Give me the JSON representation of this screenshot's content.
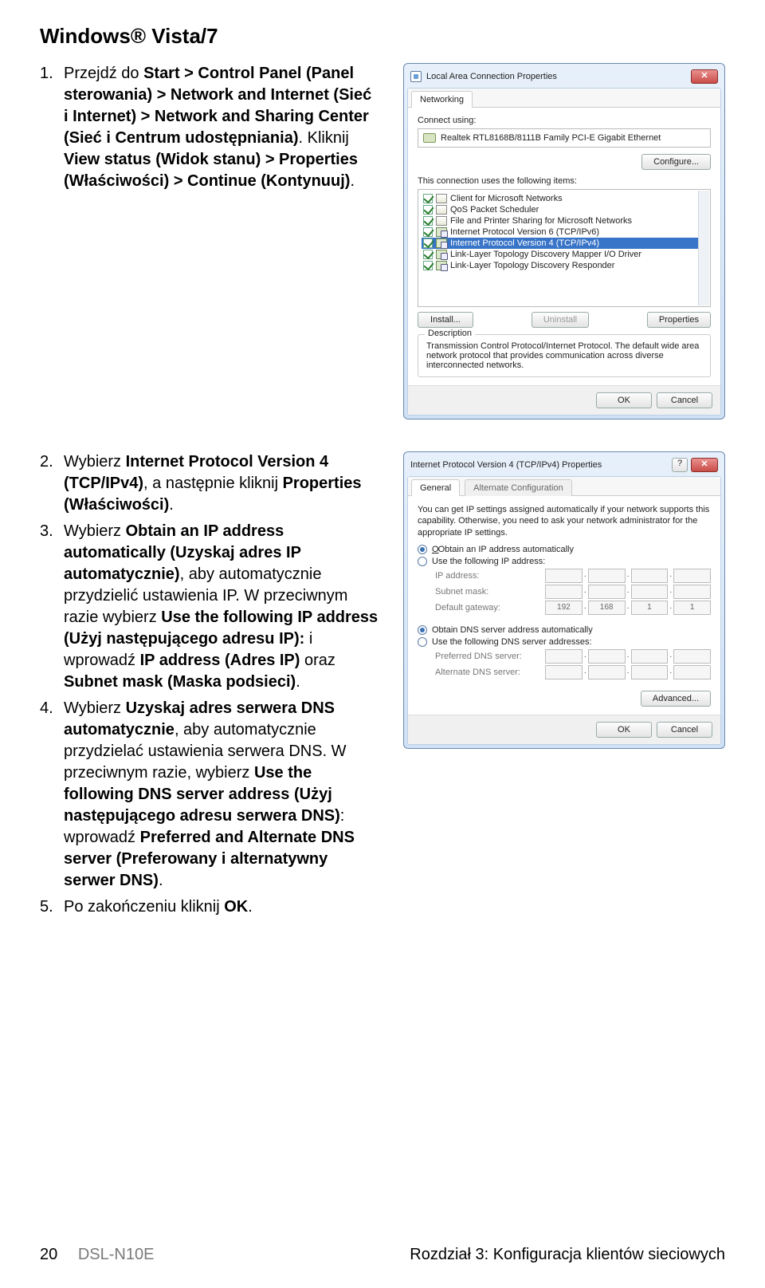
{
  "page": {
    "title": "Windows® Vista/7",
    "footer_page": "20",
    "footer_model": "DSL-N10E",
    "footer_chapter": "Rozdział 3: Konfiguracja klientów sieciowych"
  },
  "steps_a": [
    {
      "num": "1.",
      "pre": "Przejdź do ",
      "b1": "Start > Control Panel (Panel sterowania) > Network and Internet (Sieć i Internet) > Network and Sharing Center (Sieć i Centrum udostępniania)",
      "mid": ". Kliknij ",
      "b2": "View status (Widok stanu) > Properties (Właściwości) > Continue (Kontynuuj)",
      "post": "."
    }
  ],
  "steps_b": [
    {
      "num": "2.",
      "pre": "Wybierz ",
      "b1": "Internet Protocol Version 4 (TCP/IPv4)",
      "mid": ", a następnie kliknij ",
      "b2": "Properties (Właściwości)",
      "post": "."
    },
    {
      "num": "3.",
      "pre": "Wybierz ",
      "b1": "Obtain an IP address automatically (Uzyskaj adres IP automatycznie)",
      "mid": ", aby automatycznie przydzielić ustawienia IP. W przeciwnym razie wybierz ",
      "b2": "Use the following IP address (Użyj następującego adresu IP):",
      "mid2": " i wprowadź ",
      "b3": "IP address (Adres IP)",
      "mid3": " oraz ",
      "b4": "Subnet mask (Maska podsieci)",
      "post": "."
    },
    {
      "num": "4.",
      "pre": "Wybierz ",
      "b1": "Uzyskaj adres serwera DNS automatycznie",
      "mid": ", aby automatycznie przydzielać ustawienia serwera DNS. W przeciwnym razie, wybierz ",
      "b2": "Use the following DNS server address (Użyj następującego adresu serwera DNS)",
      "mid2": ": wprowadź ",
      "b3": "Preferred and Alternate DNS server (Preferowany i alternatywny serwer DNS)",
      "post": "."
    },
    {
      "num": "5.",
      "pre": "Po zakończeniu kliknij ",
      "b1": "OK",
      "post": "."
    }
  ],
  "dlg1": {
    "title": "Local Area Connection Properties",
    "tab": "Networking",
    "connect_using": "Connect using:",
    "nic": "Realtek RTL8168B/8111B Family PCI-E Gigabit Ethernet",
    "configure": "Configure...",
    "uses_label": "This connection uses the following items:",
    "items": [
      "Client for Microsoft Networks",
      "QoS Packet Scheduler",
      "File and Printer Sharing for Microsoft Networks",
      "Internet Protocol Version 6 (TCP/IPv6)",
      "Internet Protocol Version 4 (TCP/IPv4)",
      "Link-Layer Topology Discovery Mapper I/O Driver",
      "Link-Layer Topology Discovery Responder"
    ],
    "install": "Install...",
    "uninstall": "Uninstall",
    "properties": "Properties",
    "desc_legend": "Description",
    "description": "Transmission Control Protocol/Internet Protocol. The default wide area network protocol that provides communication across diverse interconnected networks.",
    "ok": "OK",
    "cancel": "Cancel"
  },
  "dlg2": {
    "title": "Internet Protocol Version 4 (TCP/IPv4) Properties",
    "tab_general": "General",
    "tab_alt": "Alternate Configuration",
    "intro": "You can get IP settings assigned automatically if your network supports this capability. Otherwise, you need to ask your network administrator for the appropriate IP settings.",
    "r_auto_ip": "Obtain an IP address automatically",
    "r_use_ip": "Use the following IP address:",
    "f_ip": "IP address:",
    "f_mask": "Subnet mask:",
    "f_gw": "Default gateway:",
    "gw_vals": [
      "192",
      "168",
      "1",
      "1"
    ],
    "r_auto_dns": "Obtain DNS server address automatically",
    "r_use_dns": "Use the following DNS server addresses:",
    "f_pdns": "Preferred DNS server:",
    "f_adns": "Alternate DNS server:",
    "advanced": "Advanced...",
    "ok": "OK",
    "cancel": "Cancel"
  }
}
